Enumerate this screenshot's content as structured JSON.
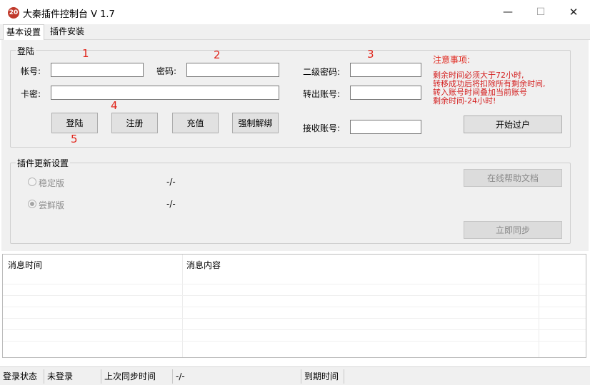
{
  "window": {
    "title": "大秦插件控制台 V 1.7",
    "icon_text": "20",
    "minimize_glyph": "—",
    "maximize_glyph": "☐",
    "close_glyph": "✕"
  },
  "tabs": [
    {
      "label": "基本设置",
      "active": true
    },
    {
      "label": "插件安装",
      "active": false
    }
  ],
  "login_group": {
    "legend": "登陆",
    "account_label": "帐号:",
    "account_value": "",
    "password_label": "密码:",
    "password_value": "",
    "card_label": "卡密:",
    "card_value": "",
    "second_password_label": "二级密码:",
    "second_password_value": "",
    "transfer_out_label": "转出账号:",
    "transfer_out_value": "",
    "receive_label": "接收账号:",
    "receive_value": "",
    "buttons": {
      "login": "登陆",
      "register": "注册",
      "recharge": "充值",
      "force_unbind": "强制解绑",
      "start_transfer": "开始过户"
    },
    "notice_title": "注意事项:",
    "notice_lines": [
      "剩余时间必须大于72小时,",
      "转移成功后将扣除所有剩余时间,",
      "转入账号时间叠加当前账号",
      "剩余时间-24小时!"
    ]
  },
  "annotations": [
    "1",
    "2",
    "3",
    "4",
    "5"
  ],
  "update_group": {
    "legend": "插件更新设置",
    "stable_label": "稳定版",
    "stable_version": "-/-",
    "beta_label": "尝鲜版",
    "beta_version": "-/-",
    "help_button": "在线帮助文档",
    "sync_button": "立即同步"
  },
  "log": {
    "columns": [
      "消息时间",
      "消息内容"
    ],
    "rows": []
  },
  "status": {
    "login_state_label": "登录状态",
    "login_state_value": "未登录",
    "last_sync_label": "上次同步时间",
    "last_sync_value": "-/-",
    "expire_label": "到期时间",
    "expire_value": ""
  },
  "colors": {
    "accent_red": "#e0251b",
    "panel_bg": "#f0f0f0"
  }
}
